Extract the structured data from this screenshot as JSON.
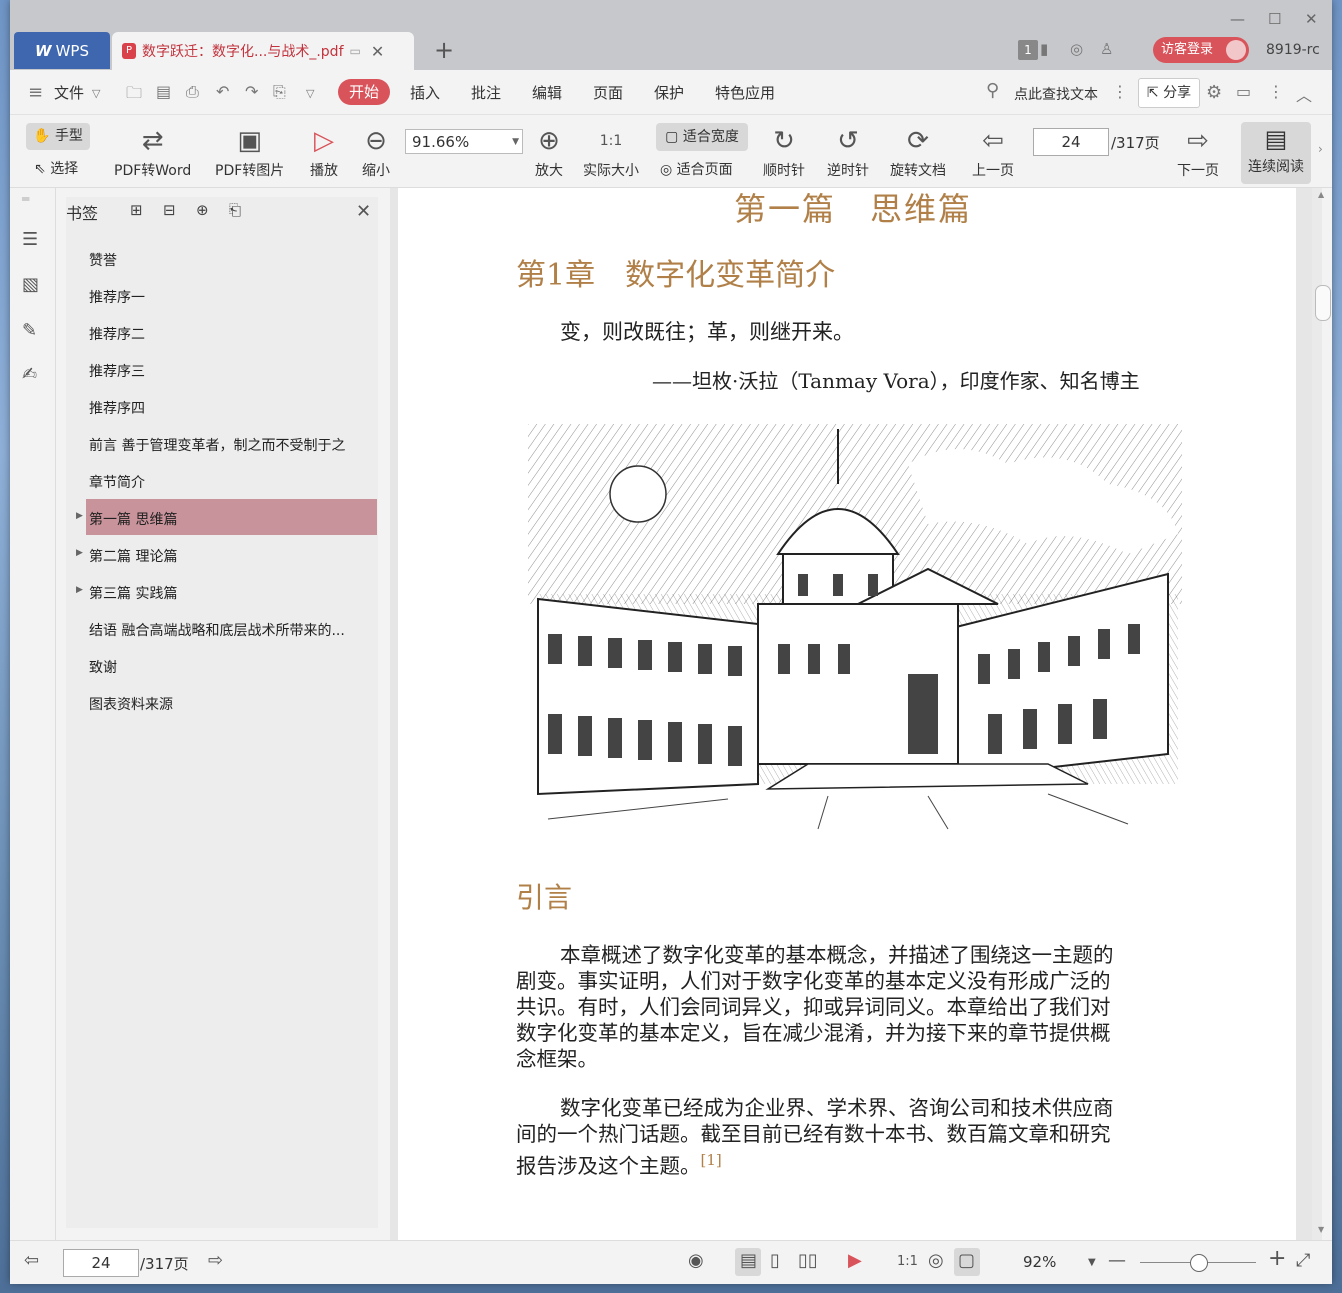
{
  "titlebar": {
    "app_label": "WPS",
    "doc_tab_title": "数字跃迁：数字化...与战术_.pdf",
    "page_count_badge": "1",
    "login_label": "访客登录",
    "user_id": "8919-rc"
  },
  "menu": {
    "file_label": "文件",
    "tabs": [
      "开始",
      "插入",
      "批注",
      "编辑",
      "页面",
      "保护",
      "特色应用"
    ],
    "active_tab": "开始",
    "search_placeholder": "点此查找文本",
    "share_label": "分享"
  },
  "ribbon": {
    "hand_label": "手型",
    "select_label": "选择",
    "pdf_to_word": "PDF转Word",
    "pdf_to_image": "PDF转图片",
    "play": "播放",
    "zoom_out": "缩小",
    "zoom_value": "91.66%",
    "zoom_in": "放大",
    "actual_size": "实际大小",
    "fit_width": "适合宽度",
    "fit_page": "适合页面",
    "rotate_cw": "顺时针",
    "rotate_ccw": "逆时针",
    "rotate_doc": "旋转文档",
    "prev_page": "上一页",
    "current_page": "24",
    "total_pages": "/317页",
    "next_page": "下一页",
    "continuous_read": "连续阅读"
  },
  "bookmarks": {
    "header": "书签",
    "items": [
      {
        "label": "赞誉",
        "expandable": false
      },
      {
        "label": "推荐序一",
        "expandable": false
      },
      {
        "label": "推荐序二",
        "expandable": false
      },
      {
        "label": "推荐序三",
        "expandable": false
      },
      {
        "label": "推荐序四",
        "expandable": false
      },
      {
        "label": "前言 善于管理变革者，制之而不受制于之",
        "expandable": false
      },
      {
        "label": "章节简介",
        "expandable": false
      },
      {
        "label": "第一篇 思维篇",
        "expandable": true
      },
      {
        "label": "第二篇 理论篇",
        "expandable": true
      },
      {
        "label": "第三篇 实践篇",
        "expandable": true
      },
      {
        "label": "结语 融合高端战略和底层战术所带来的...",
        "expandable": false
      },
      {
        "label": "致谢",
        "expandable": false
      },
      {
        "label": "图表资料来源",
        "expandable": false
      }
    ],
    "selected_index": 7
  },
  "document": {
    "part_title": "第一篇　思维篇",
    "chapter_title": "第1章　数字化变革简介",
    "epigraph": "变，则改既往；革，则继开来。",
    "attribution": "——坦枚·沃拉（Tanmay Vora），印度作家、知名博主",
    "section_title": "引言",
    "para1_lines": [
      "本章概述了数字化变革的基本概念，并描述了围绕这一主题的",
      "剧变。事实证明，人们对于数字化变革的基本定义没有形成广泛的",
      "共识。有时，人们会同词异义，抑或异词同义。本章给出了我们对",
      "数字化变革的基本定义，旨在减少混淆，并为接下来的章节提供概",
      "念框架。"
    ],
    "para2_lines": [
      "数字化变革已经成为企业界、学术界、咨询公司和技术供应商",
      "间的一个热门话题。截至目前已经有数十本书、数百篇文章和研究",
      "报告涉及这个主题。"
    ],
    "footnote_ref": "[1]"
  },
  "statusbar": {
    "current_page": "24",
    "total_pages": "/317页",
    "zoom_percent": "92%",
    "zoom_fraction": 0.5
  },
  "colors": {
    "accent": "#d9535a",
    "heading": "#b08048",
    "selection": "#c9939b",
    "wps_blue": "#3f67b0"
  }
}
